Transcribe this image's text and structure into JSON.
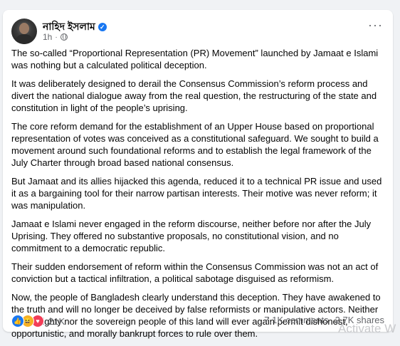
{
  "post": {
    "author": "নাহিদ ইসলাম",
    "time": "1h",
    "separator": "·",
    "paragraphs": [
      "The so-called “Proportional Representation (PR) Movement” launched by Jamaat e Islami was nothing but a calculated political deception.",
      "It was deliberately designed to derail the Consensus Commission’s reform process and divert the national dialogue away from the real question, the restructuring of the state and constitution in light of the people’s uprising.",
      "The core reform demand for the establishment of an Upper House based on proportional representation of votes was conceived as a constitutional safeguard. We sought to build a movement around such foundational reforms and to establish the legal framework of the July Charter through broad based national consensus.",
      "But Jamaat and its allies hijacked this agenda, reduced it to a technical PR issue and used it as a bargaining tool for their narrow partisan interests. Their motive was never reform; it was manipulation.",
      "Jamaat e Islami never engaged in the reform discourse, neither before nor after the July Uprising. They offered no substantive proposals, no constitutional vision, and no commitment to a democratic republic.",
      "Their sudden endorsement of reform within the Consensus Commission was not an act of conviction but a tactical infiltration, a political sabotage disguised as reformism.",
      "Now, the people of Bangladesh clearly understand this deception. They have awakened to the truth and will no longer be deceived by false reformists or manipulative actors. Neither the Almighty nor the sovereign people of this land will ever again permit dishonest, opportunistic, and morally bankrupt forces to rule over them."
    ],
    "reaction_count": "21K",
    "comments": "7.1K comments",
    "shares": "2.7K shares"
  },
  "icons": {
    "verified": "verified-badge-icon",
    "audience": "globe-icon",
    "more": "more-options-icon",
    "reactions": [
      "like-icon",
      "haha-icon",
      "love-icon"
    ]
  },
  "colors": {
    "accent": "#1877f2",
    "secondary_text": "#65676b",
    "background": "#f0f2f5"
  },
  "watermark": "Activate W"
}
